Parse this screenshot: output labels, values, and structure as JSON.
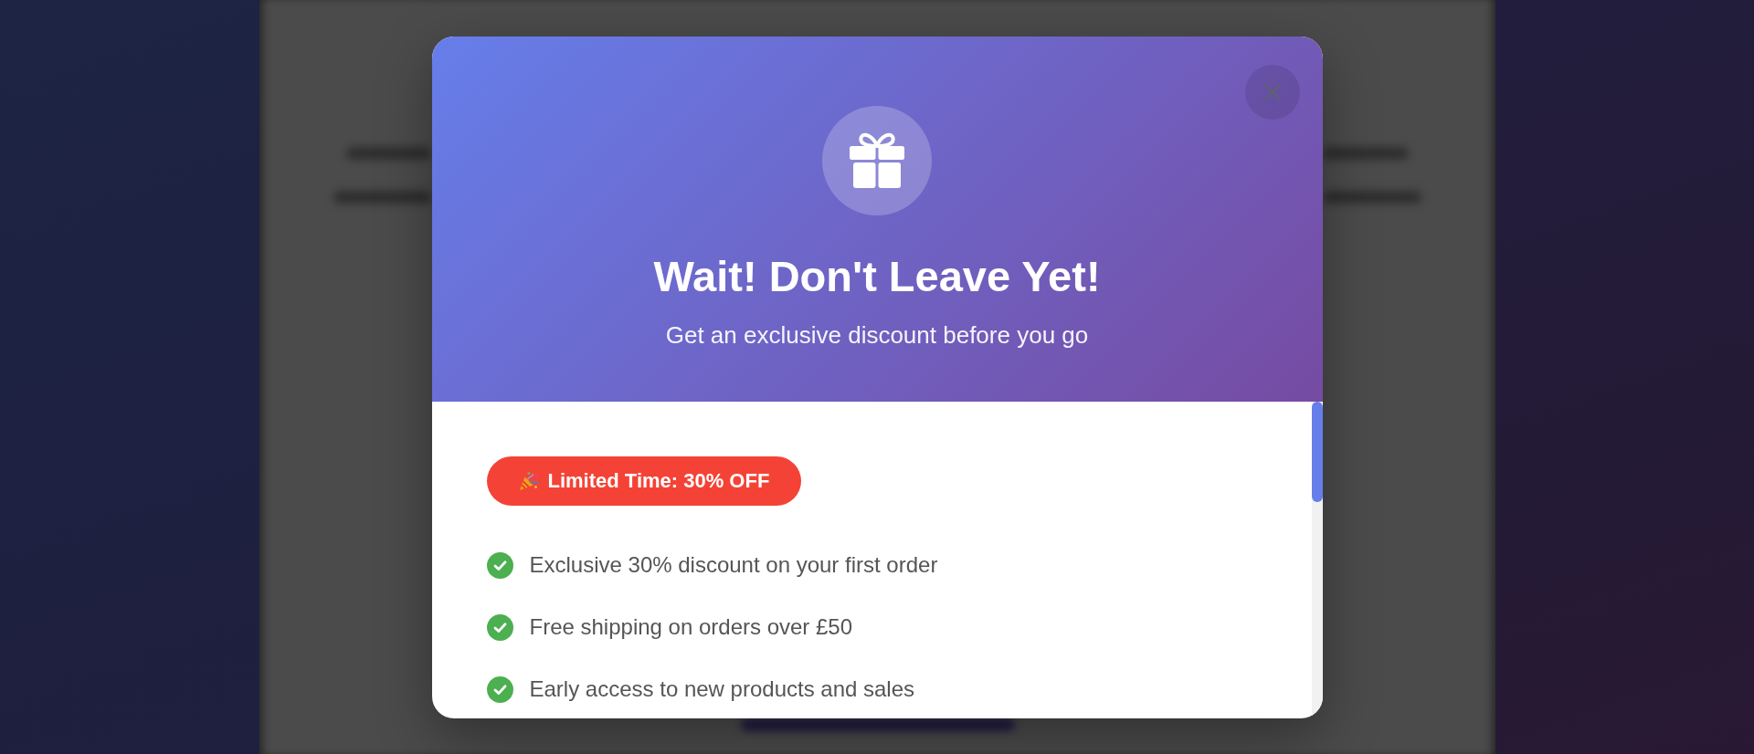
{
  "popup": {
    "title": "Wait! Don't Leave Yet!",
    "subtitle": "Get an exclusive discount before you go"
  },
  "offer_badge": {
    "label": "Limited Time: 30% OFF"
  },
  "benefits": [
    "Exclusive 30% discount on your first order",
    "Free shipping on orders over £50",
    "Early access to new products and sales"
  ]
}
